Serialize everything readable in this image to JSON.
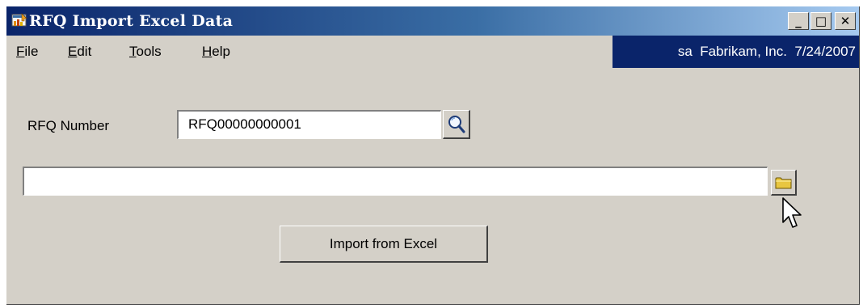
{
  "window": {
    "title": "RFQ Import Excel Data",
    "buttons": {
      "minimize": "_",
      "maximize": "□",
      "close": "✕"
    }
  },
  "menu": {
    "items": [
      {
        "accel": "F",
        "rest": "ile"
      },
      {
        "accel": "E",
        "rest": "dit"
      },
      {
        "accel": "T",
        "rest": "ools"
      },
      {
        "accel": "H",
        "rest": "elp"
      }
    ]
  },
  "user_info": {
    "user": "sa",
    "company": "Fabrikam, Inc.",
    "date": "7/24/2007",
    "text": "sa  Fabrikam, Inc.  7/24/2007"
  },
  "form": {
    "rfq_number_label": "RFQ Number",
    "rfq_number_value": "RFQ00000000001",
    "file_path_value": "",
    "import_button_label": "Import from Excel"
  },
  "icons": {
    "app": "app-icon",
    "lookup": "magnifier-icon",
    "folder": "folder-icon",
    "cursor": "mouse-pointer-icon"
  },
  "colors": {
    "title_bar": "#0a246a",
    "window_face": "#d4d0c8",
    "user_info_bg": "#0a246a"
  }
}
